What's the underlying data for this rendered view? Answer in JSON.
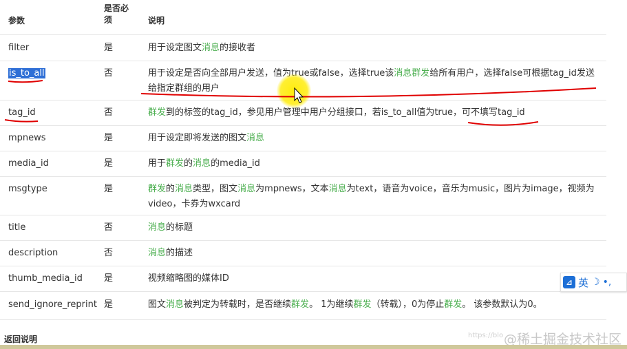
{
  "header": {
    "col_param": "参数",
    "col_required": "是否必\n须",
    "col_desc": "说明"
  },
  "rows": [
    {
      "param": "filter",
      "required": "是",
      "desc": [
        {
          "t": "用于设定图文"
        },
        {
          "t": "消息",
          "hl": true
        },
        {
          "t": "的接收者"
        }
      ]
    },
    {
      "param": "is_to_all",
      "required": "否",
      "selected": true,
      "desc": [
        {
          "t": "用于设定是否向全部用户发送，值为true或false，选择true该"
        },
        {
          "t": "消息群发",
          "hl": true
        },
        {
          "t": "给所有用户，选择false可根据tag_id发送给指定群组的用户"
        }
      ]
    },
    {
      "param": "tag_id",
      "required": "否",
      "desc": [
        {
          "t": "群发",
          "hl": true
        },
        {
          "t": "到的标签的tag_id，参见用户管理中用户分组接口，若is_to_all值为true，可不填写tag_id"
        }
      ]
    },
    {
      "param": "mpnews",
      "required": "是",
      "desc": [
        {
          "t": "用于设定即将发送的图文"
        },
        {
          "t": "消息",
          "hl": true
        }
      ]
    },
    {
      "param": "media_id",
      "required": "是",
      "desc": [
        {
          "t": "用于"
        },
        {
          "t": "群发",
          "hl": true
        },
        {
          "t": "的"
        },
        {
          "t": "消息",
          "hl": true
        },
        {
          "t": "的media_id"
        }
      ]
    },
    {
      "param": "msgtype",
      "required": "是",
      "desc": [
        {
          "t": "群发",
          "hl": true
        },
        {
          "t": "的"
        },
        {
          "t": "消息",
          "hl": true
        },
        {
          "t": "类型，图文"
        },
        {
          "t": "消息",
          "hl": true
        },
        {
          "t": "为mpnews，文本"
        },
        {
          "t": "消息",
          "hl": true
        },
        {
          "t": "为text，语音为voice，音乐为music，图片为image，视频为video，卡券为wxcard"
        }
      ]
    },
    {
      "param": "title",
      "required": "否",
      "desc": [
        {
          "t": "消息",
          "hl": true
        },
        {
          "t": "的标题"
        }
      ]
    },
    {
      "param": "description",
      "required": "否",
      "desc": [
        {
          "t": "消息",
          "hl": true
        },
        {
          "t": "的描述"
        }
      ]
    },
    {
      "param": "thumb_media_id",
      "required": "是",
      "desc": [
        {
          "t": "视频缩略图的媒体ID"
        }
      ]
    },
    {
      "param": "send_ignore_reprint",
      "required": "是",
      "desc": [
        {
          "t": "图文"
        },
        {
          "t": "消息",
          "hl": true
        },
        {
          "t": "被判定为转载时，是否继续"
        },
        {
          "t": "群发",
          "hl": true
        },
        {
          "t": "。 1为继续"
        },
        {
          "t": "群发",
          "hl": true
        },
        {
          "t": "（转载），0为停止"
        },
        {
          "t": "群发",
          "hl": true
        },
        {
          "t": "。 该参数默认为0。"
        }
      ]
    }
  ],
  "section": {
    "return_title": "返回说明"
  },
  "ime": {
    "label": "英"
  },
  "watermark": {
    "text": "@稀土掘金技术社区",
    "small": "https://blo"
  },
  "colors": {
    "highlight": "#4caf50",
    "selection": "#2f6fd6",
    "annotation": "#e00000"
  }
}
